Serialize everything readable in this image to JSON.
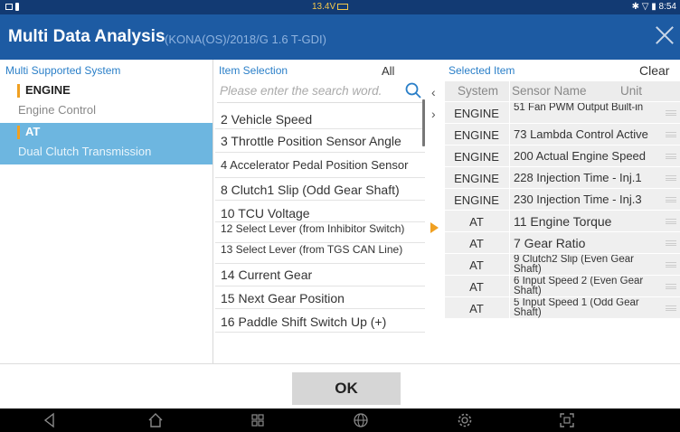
{
  "status": {
    "voltage": "13.4V",
    "time": "8:54"
  },
  "title": {
    "main": "Multi Data Analysis",
    "vehicle": "(KONA(OS)/2018/G 1.6 T-GDI)"
  },
  "left": {
    "header": "Multi Supported System",
    "systems": [
      {
        "name": "ENGINE",
        "sub": "Engine Control"
      },
      {
        "name": "AT",
        "sub": "Dual Clutch Transmission"
      }
    ]
  },
  "middle": {
    "header": "Item Selection",
    "all_button": "All",
    "search_placeholder": "Please enter the search word.",
    "items": [
      "2 Vehicle Speed",
      "3 Throttle Position Sensor Angle",
      "4 Accelerator Pedal Position Sensor",
      "8 Clutch1 Slip (Odd Gear Shaft)",
      "10 TCU Voltage",
      "12 Select Lever (from Inhibitor Switch)",
      "13 Select Lever (from TGS CAN Line)",
      "14 Current Gear",
      "15 Next Gear Position",
      "16 Paddle Shift Switch Up (+)"
    ]
  },
  "right": {
    "header": "Selected Item",
    "clear_button": "Clear",
    "columns": {
      "system": "System",
      "sensor": "Sensor Name",
      "unit": "Unit"
    },
    "rows": [
      {
        "system": "ENGINE",
        "sensor": "51 Fan PWM Output Built-in"
      },
      {
        "system": "ENGINE",
        "sensor": "73 Lambda Control Active"
      },
      {
        "system": "ENGINE",
        "sensor": "200 Actual Engine Speed"
      },
      {
        "system": "ENGINE",
        "sensor": "228 Injection Time - Inj.1"
      },
      {
        "system": "ENGINE",
        "sensor": "230 Injection Time - Inj.3"
      },
      {
        "system": "AT",
        "sensor": "11 Engine Torque"
      },
      {
        "system": "AT",
        "sensor": "7 Gear Ratio"
      },
      {
        "system": "AT",
        "sensor": "9 Clutch2 Slip (Even Gear Shaft)"
      },
      {
        "system": "AT",
        "sensor": "6 Input Speed 2 (Even Gear Shaft)"
      },
      {
        "system": "AT",
        "sensor": "5 Input Speed 1 (Odd Gear Shaft)"
      }
    ]
  },
  "ok_button": "OK",
  "colors": {
    "title_bar": "#1d5ba3",
    "status_bar": "#123a73",
    "selected_system": "#6db6e0",
    "accent": "#f0a021",
    "header_text": "#2a7fc8"
  },
  "icons": [
    "close-icon",
    "search-icon",
    "chevron-left-icon",
    "chevron-right-icon",
    "pointer-triangle-icon",
    "drag-handle-icon",
    "back-icon",
    "home-icon",
    "recent-apps-icon",
    "globe-icon",
    "settings-gear-icon",
    "screenshot-icon"
  ]
}
